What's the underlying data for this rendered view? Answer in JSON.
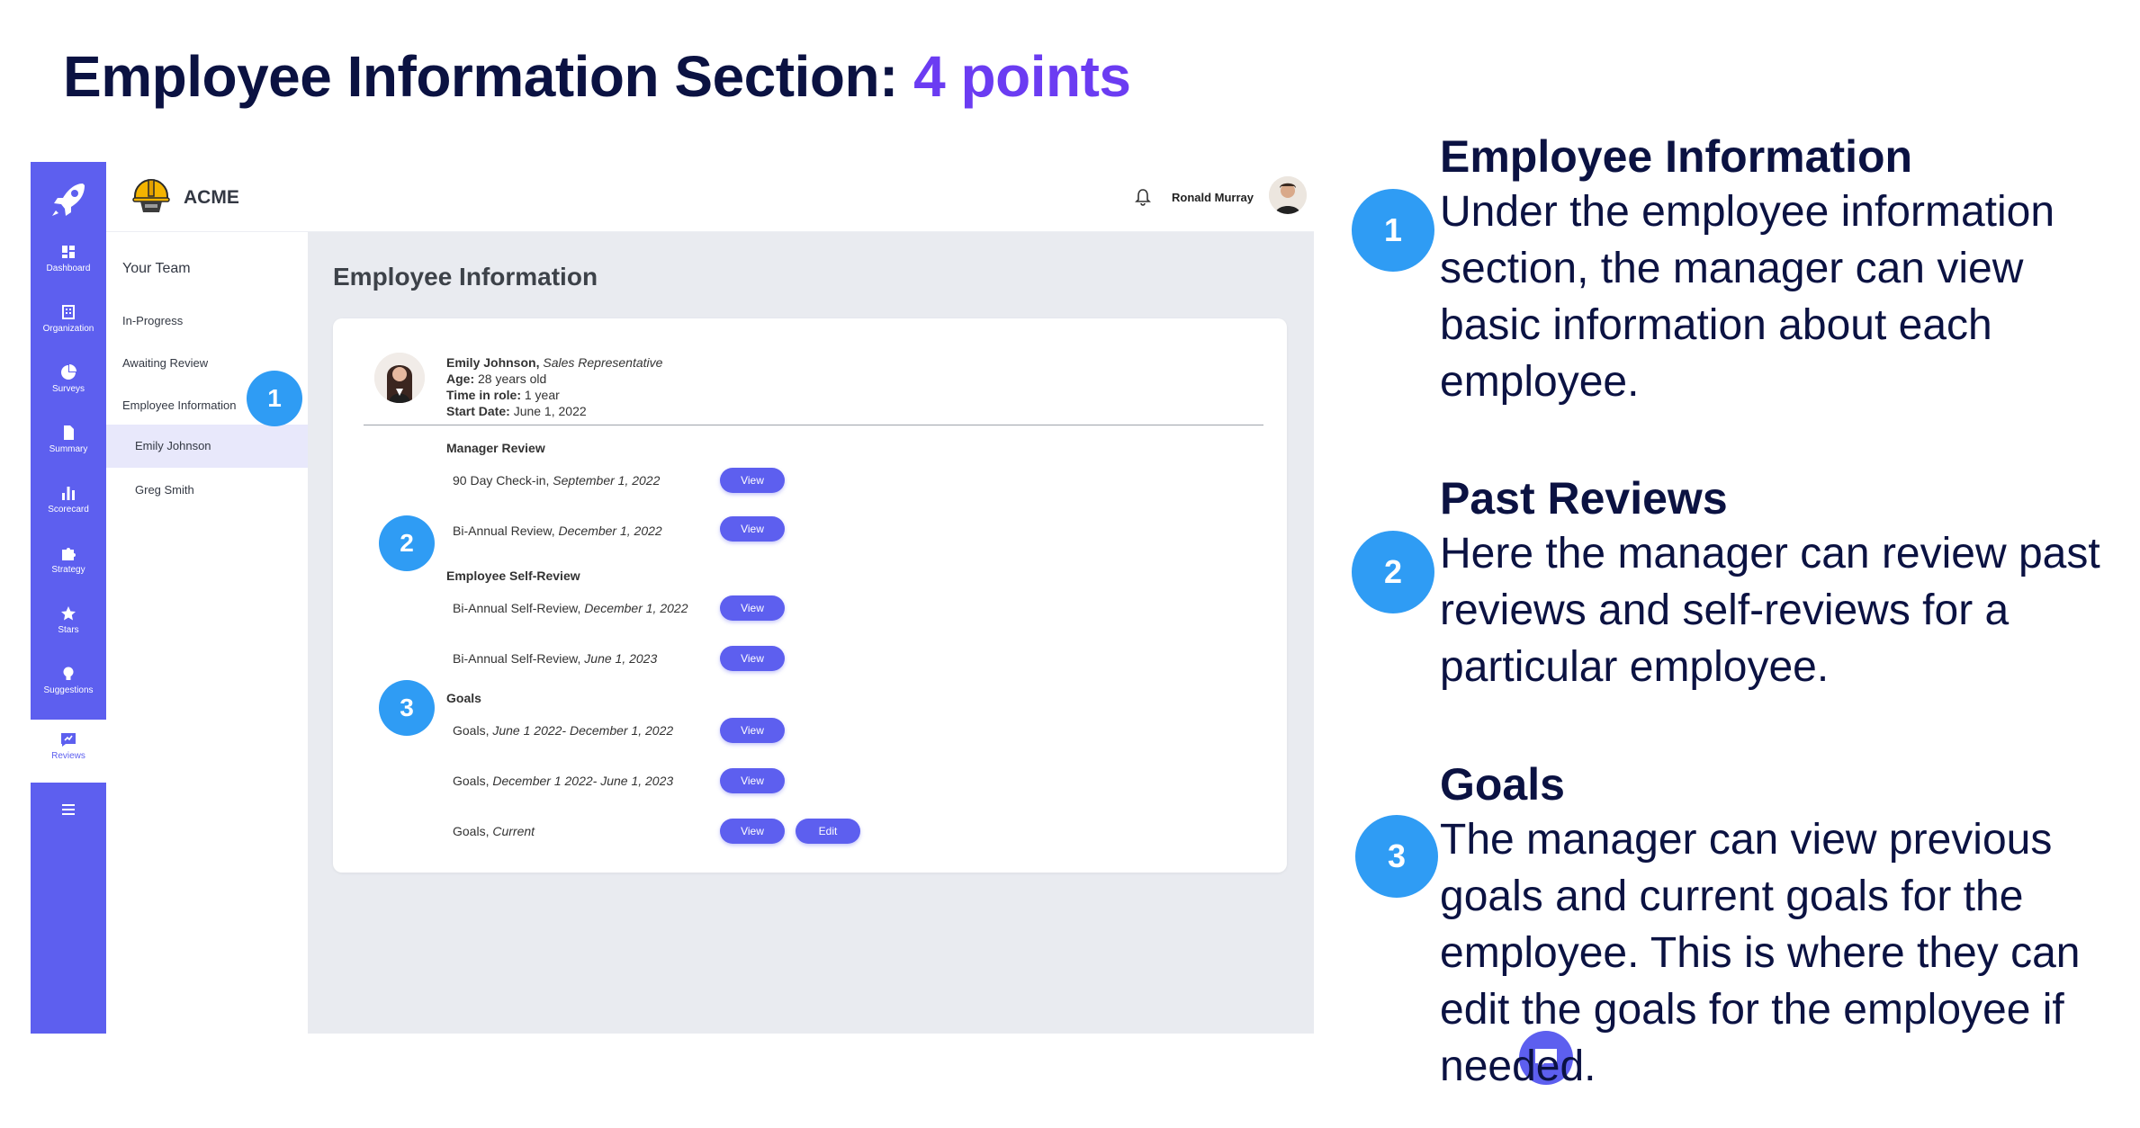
{
  "slide": {
    "title_main": "Employee Information Section:",
    "title_accent": "4 points"
  },
  "rail": {
    "items": [
      {
        "label": "Dashboard",
        "icon": "dashboard-icon"
      },
      {
        "label": "Organization",
        "icon": "organization-icon"
      },
      {
        "label": "Surveys",
        "icon": "pie-chart-icon"
      },
      {
        "label": "Summary",
        "icon": "document-icon"
      },
      {
        "label": "Scorecard",
        "icon": "bar-chart-icon"
      },
      {
        "label": "Strategy",
        "icon": "puzzle-icon"
      },
      {
        "label": "Stars",
        "icon": "star-icon"
      },
      {
        "label": "Suggestions",
        "icon": "lightbulb-icon"
      },
      {
        "label": "Reviews",
        "icon": "reviews-icon"
      }
    ],
    "menu_icon": "hamburger-icon",
    "accent_color": "#5d5fef"
  },
  "topbar": {
    "brand": "ACME",
    "user_name": "Ronald Murray"
  },
  "subnav": {
    "title": "Your Team",
    "items": [
      "In-Progress",
      "Awaiting Review",
      "Employee Information",
      "Emily Johnson",
      "Greg Smith"
    ]
  },
  "main": {
    "title": "Employee Information"
  },
  "employee": {
    "name": "Emily Johnson,",
    "role": "Sales Representative",
    "age_label": "Age:",
    "age": "28 years old",
    "time_label": "Time in role:",
    "time": "1 year",
    "start_label": "Start Date:",
    "start": "June 1, 2022"
  },
  "sections": {
    "manager_review": {
      "title": "Manager Review",
      "rows": [
        {
          "label": "90 Day Check-in,",
          "date": "September 1, 2022",
          "action": "View"
        },
        {
          "label": "Bi-Annual Review,",
          "date": "December 1, 2022",
          "action": "View"
        }
      ]
    },
    "self_review": {
      "title": "Employee Self-Review",
      "rows": [
        {
          "label": "Bi-Annual Self-Review,",
          "date": "December 1, 2022",
          "action": "View"
        },
        {
          "label": "Bi-Annual Self-Review,",
          "date": "June 1, 2023",
          "action": "View"
        }
      ]
    },
    "goals": {
      "title": "Goals",
      "rows": [
        {
          "label": "Goals,",
          "date": "June 1 2022- December 1, 2022",
          "action": "View"
        },
        {
          "label": "Goals,",
          "date": "December 1 2022- June 1, 2023",
          "action": "View"
        },
        {
          "label": "Goals,",
          "date": "Current",
          "action": "View",
          "action2": "Edit"
        }
      ]
    }
  },
  "badges": [
    "1",
    "2",
    "3"
  ],
  "explanations": [
    {
      "heading": "Employee Information",
      "body": "Under the employee information section, the manager can view basic information about each employee."
    },
    {
      "heading": "Past Reviews",
      "body": "Here the manager can review past reviews and self-reviews for a particular employee."
    },
    {
      "heading": "Goals",
      "body": "The manager can view previous goals and current goals for the employee. This is where they can edit the goals for the employee if needed."
    }
  ],
  "colors": {
    "title_navy": "#0b1242",
    "title_accent": "#6b3cf2",
    "badge_blue": "#2f9cf4"
  }
}
